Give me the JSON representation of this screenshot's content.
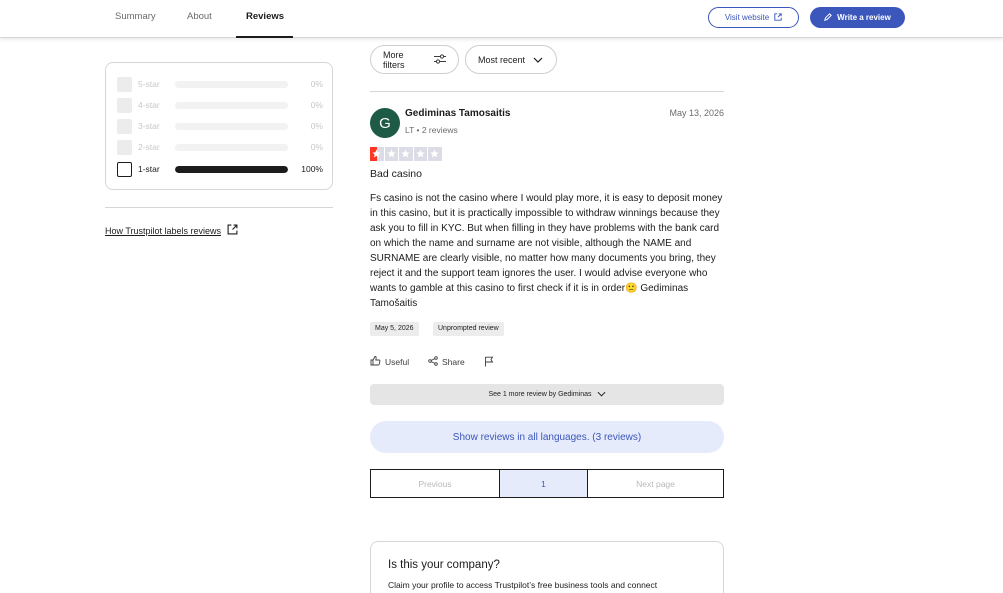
{
  "nav": {
    "tabs": [
      {
        "label": "Summary"
      },
      {
        "label": "About"
      },
      {
        "label": "Reviews"
      }
    ],
    "visit_website": "Visit website",
    "write_review": "Write a review",
    "accent_color": "#3c57bc"
  },
  "star_filter": {
    "rows": [
      {
        "label": "5-star",
        "percent": "0%",
        "fraction": 0
      },
      {
        "label": "4-star",
        "percent": "0%",
        "fraction": 0
      },
      {
        "label": "3-star",
        "percent": "0%",
        "fraction": 0
      },
      {
        "label": "2-star",
        "percent": "0%",
        "fraction": 0
      },
      {
        "label": "1-star",
        "percent": "100%",
        "fraction": 1
      }
    ],
    "labels_link": "How Trustpilot labels reviews"
  },
  "filters": {
    "more_filters": "More filters",
    "sort": "Most recent"
  },
  "review": {
    "avatar_letter": "G",
    "avatar_color": "#1e5b46",
    "name": "Gediminas Tamosaitis",
    "meta": "LT • 2 reviews",
    "date": "May 13, 2026",
    "rating": 1,
    "rating_color": "#ff3722",
    "title": "Bad casino",
    "body": "Fs casino is not the casino where I would play more, it is easy to deposit money in this casino, but it is practically impossible to withdraw winnings because they ask you to fill in KYC. But when filling in they have problems with the bank card on which the name and surname are not visible, although the NAME and SURNAME are clearly visible, no matter how many documents you bring, they reject it and the support team ignores the user. I would advise everyone who wants to gamble at this casino to first check if it is in order🙁 Gediminas Tamošaitis",
    "experience_date": "May 5, 2026",
    "review_type": "Unprompted review",
    "useful": "Useful",
    "share": "Share"
  },
  "see_more": "See 1 more review by Gediminas",
  "show_languages": "Show reviews in all languages. (3 reviews)",
  "pagination": {
    "previous": "Previous",
    "current": "1",
    "next": "Next page"
  },
  "company_card": {
    "title": "Is this your company?",
    "text": "Claim your profile to access Trustpilot’s free business tools and connect"
  }
}
